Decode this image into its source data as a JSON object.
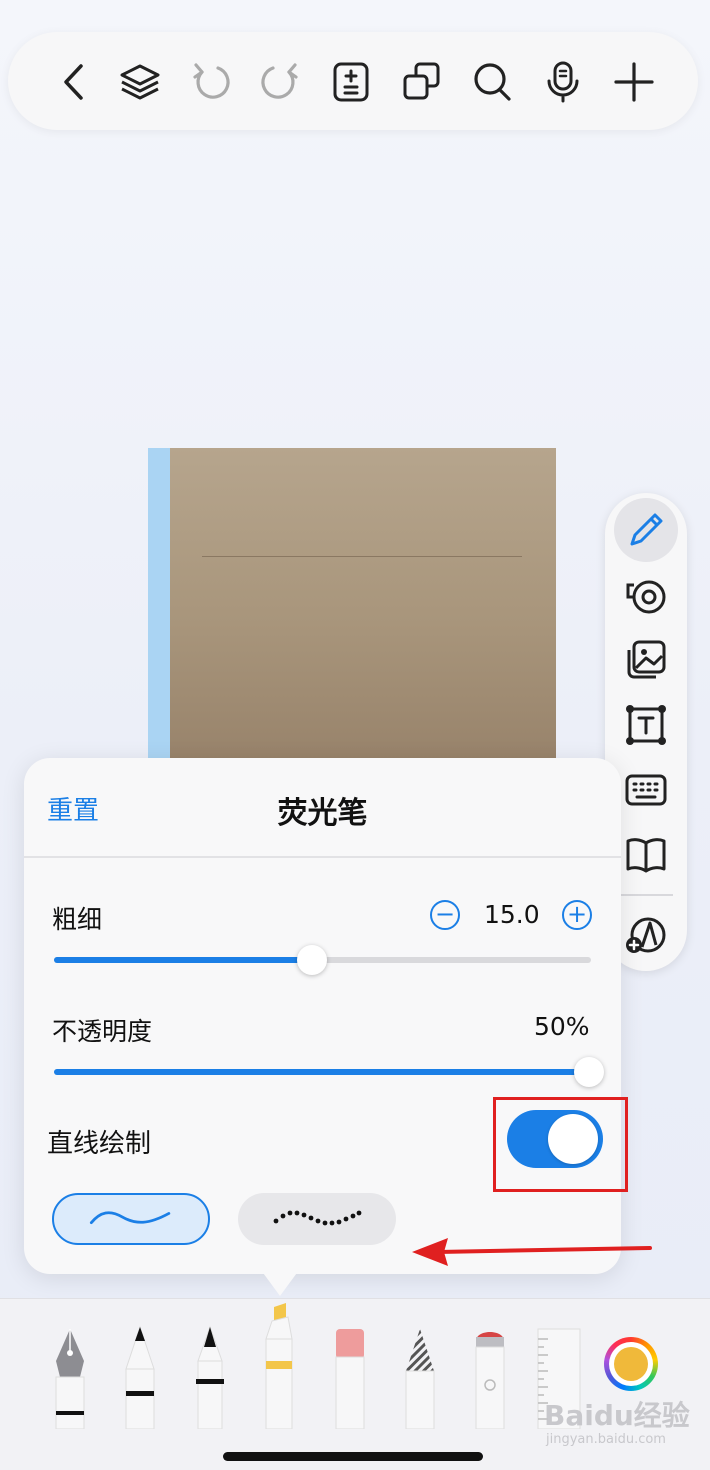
{
  "top_toolbar": {
    "icons": [
      "back-icon",
      "layers-icon",
      "undo-icon",
      "redo-icon",
      "page-add-icon",
      "copy-icon",
      "search-icon",
      "microphone-icon",
      "add-icon"
    ]
  },
  "side_palette": {
    "icons": [
      "pencil-icon",
      "tape-icon",
      "image-icon",
      "text-box-icon",
      "keyboard-icon",
      "book-icon",
      "add-shape-icon"
    ],
    "active": "pencil-icon"
  },
  "popover": {
    "reset_label": "重置",
    "title": "荧光笔",
    "thickness": {
      "label": "粗细",
      "value_text": "15.0",
      "level": 0.48,
      "decrement": "−",
      "increment": "+"
    },
    "opacity": {
      "label": "不透明度",
      "value_text": "50%",
      "level": 1.0
    },
    "straight_line": {
      "label": "直线绘制",
      "enabled": true
    },
    "stroke_styles": [
      "solid-wave",
      "dotted-wave"
    ],
    "selected_style": "solid-wave"
  },
  "tool_tray": {
    "tools": [
      "fountain-pen",
      "ballpoint-pen",
      "fine-pen",
      "highlighter",
      "eraser",
      "pencil",
      "marker",
      "ruler"
    ],
    "selected_tool": "highlighter",
    "current_color": "#f0b93a"
  },
  "colors": {
    "accent": "#1b7fe6",
    "highlight_red": "#e02020",
    "notebook_spine": "#aad4f3"
  },
  "watermark": {
    "main": "Baidu经验",
    "sub": "jingyan.baidu.com"
  }
}
